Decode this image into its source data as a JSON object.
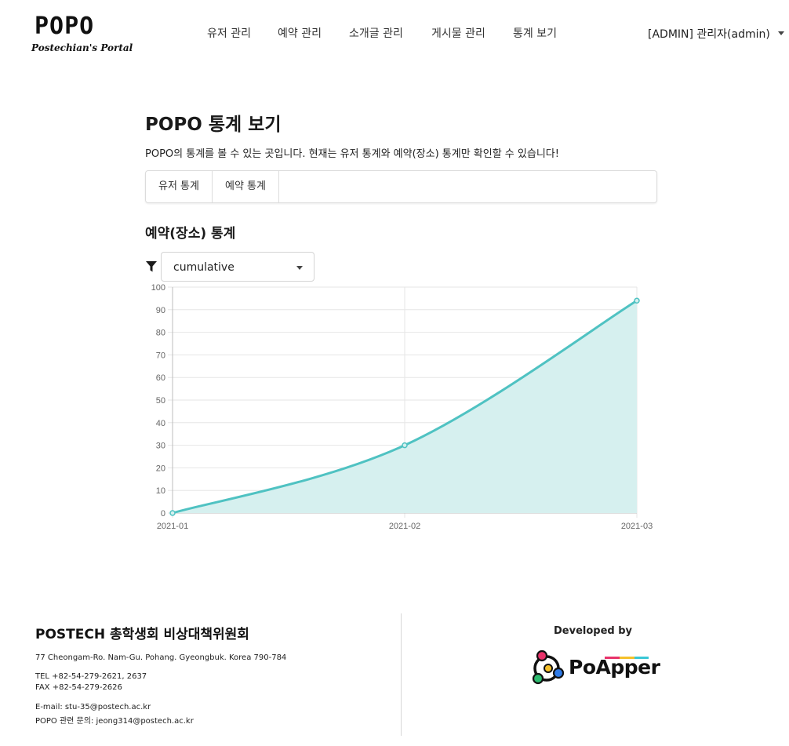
{
  "header": {
    "logo_text": "POPO",
    "logo_subtitle": "Postechian's Portal",
    "nav": [
      {
        "label": "유저 관리"
      },
      {
        "label": "예약 관리"
      },
      {
        "label": "소개글 관리"
      },
      {
        "label": "게시물 관리"
      },
      {
        "label": "통계 보기"
      }
    ],
    "user_menu": "[ADMIN] 관리자(admin)"
  },
  "main": {
    "title": "POPO 통계 보기",
    "description": "POPO의 통계를 볼 수 있는 곳입니다. 현재는 유저 통계와 예약(장소) 통계만 확인할 수 있습니다!",
    "tabs": [
      {
        "label": "유저 통계"
      },
      {
        "label": "예약 통계"
      }
    ],
    "section_title": "예약(장소) 통계",
    "filter": {
      "icon": "filter-icon",
      "selected": "cumulative"
    }
  },
  "chart_data": {
    "type": "area",
    "x": [
      "2021-01",
      "2021-02",
      "2021-03"
    ],
    "series": [
      {
        "values": [
          0,
          30,
          94
        ]
      }
    ],
    "ylim": [
      0,
      100
    ],
    "yticks": [
      0,
      10,
      20,
      30,
      40,
      50,
      60,
      70,
      80,
      90,
      100
    ],
    "grid": true,
    "line_color": "#4fc2c2",
    "fill_color": "#d6f0ef"
  },
  "footer": {
    "org_name": "POSTECH 총학생회 비상대책위원회",
    "address": "77 Cheongam-Ro. Nam-Gu. Pohang. Gyeongbuk. Korea 790-784",
    "tel": "TEL +82-54-279-2621, 2637",
    "fax": "FAX +82-54-279-2626",
    "email": "E-mail: stu-35@postech.ac.kr",
    "contact": "POPO 관련 문의: jeong314@postech.ac.kr",
    "developed_by": "Developed by",
    "developer": "PoApper"
  }
}
